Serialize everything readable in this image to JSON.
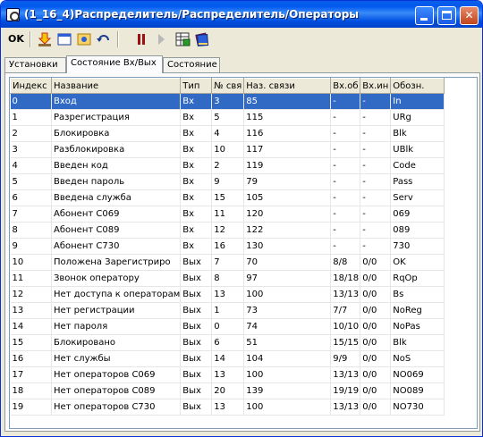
{
  "window": {
    "title": "(1_16_4)Распределитель/Распределитель/Операторы",
    "colors": {
      "titlebar": "#0058ee",
      "selection": "#316ac5"
    }
  },
  "toolbar": {
    "ok_label": "OK",
    "icons": [
      "download-arrow-icon",
      "window-icon",
      "record-icon",
      "undo-icon",
      "pause-icon",
      "play-icon",
      "table-icon",
      "books-icon"
    ]
  },
  "tabs": [
    {
      "label": "Установки"
    },
    {
      "label": "Состояние Вх/Вых",
      "active": true
    },
    {
      "label": "Состояние"
    }
  ],
  "table": {
    "columns": [
      "Индекс",
      "Название",
      "Тип",
      "№ свя",
      "Наз. связи",
      "Вх.об",
      "Вх.ин",
      "Обозн."
    ],
    "rows": [
      [
        "0",
        "Вход",
        "Вх",
        "3",
        "85",
        "-",
        "-",
        "In"
      ],
      [
        "1",
        "Разрегистрация",
        "Вх",
        "5",
        "115",
        "-",
        "-",
        "URg"
      ],
      [
        "2",
        "Блокировка",
        "Вх",
        "4",
        "116",
        "-",
        "-",
        "Blk"
      ],
      [
        "3",
        "Разблокировка",
        "Вх",
        "10",
        "117",
        "-",
        "-",
        "UBlk"
      ],
      [
        "4",
        "Введен код",
        "Вх",
        "2",
        "119",
        "-",
        "-",
        "Code"
      ],
      [
        "5",
        "Введен пароль",
        "Вх",
        "9",
        "79",
        "-",
        "-",
        "Pass"
      ],
      [
        "6",
        "Введена служба",
        "Вх",
        "15",
        "105",
        "-",
        "-",
        "Serv"
      ],
      [
        "7",
        "Абонент С069",
        "Вх",
        "11",
        "120",
        "-",
        "-",
        "069"
      ],
      [
        "8",
        "Абонент С089",
        "Вх",
        "12",
        "122",
        "-",
        "-",
        "089"
      ],
      [
        "9",
        "Абонент С730",
        "Вх",
        "16",
        "130",
        "-",
        "-",
        "730"
      ],
      [
        "10",
        "Положена Зарегистриро",
        "Вых",
        "7",
        "70",
        "8/8",
        "0/0",
        "OK"
      ],
      [
        "11",
        "Звонок оператору",
        "Вых",
        "8",
        "97",
        "18/18",
        "0/0",
        "RqOp"
      ],
      [
        "12",
        "Нет доступа к операторам",
        "Вых",
        "13",
        "100",
        "13/13",
        "0/0",
        "Bs"
      ],
      [
        "13",
        "Нет регистрации",
        "Вых",
        "1",
        "73",
        "7/7",
        "0/0",
        "NoReg"
      ],
      [
        "14",
        "Нет пароля",
        "Вых",
        "0",
        "74",
        "10/10",
        "0/0",
        "NoPas"
      ],
      [
        "15",
        "Блокировано",
        "Вых",
        "6",
        "51",
        "15/15",
        "0/0",
        "Blk"
      ],
      [
        "16",
        "Нет службы",
        "Вых",
        "14",
        "104",
        "9/9",
        "0/0",
        "NoS"
      ],
      [
        "17",
        "Нет операторов С069",
        "Вых",
        "13",
        "100",
        "13/13",
        "0/0",
        "NO069"
      ],
      [
        "18",
        "Нет операторов С089",
        "Вых",
        "20",
        "139",
        "19/19",
        "0/0",
        "NO089"
      ],
      [
        "19",
        "Нет операторов С730",
        "Вых",
        "13",
        "100",
        "13/13",
        "0/0",
        "NO730"
      ]
    ],
    "selected_row": 0
  }
}
